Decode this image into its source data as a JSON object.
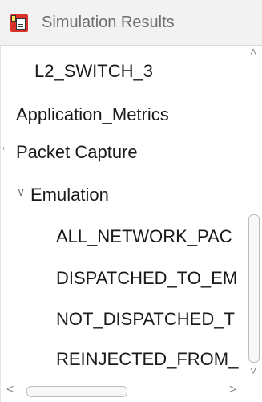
{
  "header": {
    "title": "Simulation Results",
    "icon": "simulation-report-icon"
  },
  "tree": {
    "items": [
      {
        "label": "L2_SWITCH_3"
      },
      {
        "label": "Application_Metrics"
      },
      {
        "label": "Packet Capture",
        "icon": "chevron-right-icon",
        "glyph": "ʼ"
      },
      {
        "label": "Emulation",
        "icon": "chevron-down-icon",
        "glyph": "∨",
        "expanded": true
      },
      {
        "label": "ALL_NETWORK_PAC"
      },
      {
        "label": "DISPATCHED_TO_EM"
      },
      {
        "label": "NOT_DISPATCHED_T"
      },
      {
        "label": "REINJECTED_FROM_"
      }
    ]
  },
  "scrollbars": {
    "up": "˄",
    "down": "˅",
    "left": "<",
    "right": ">"
  }
}
